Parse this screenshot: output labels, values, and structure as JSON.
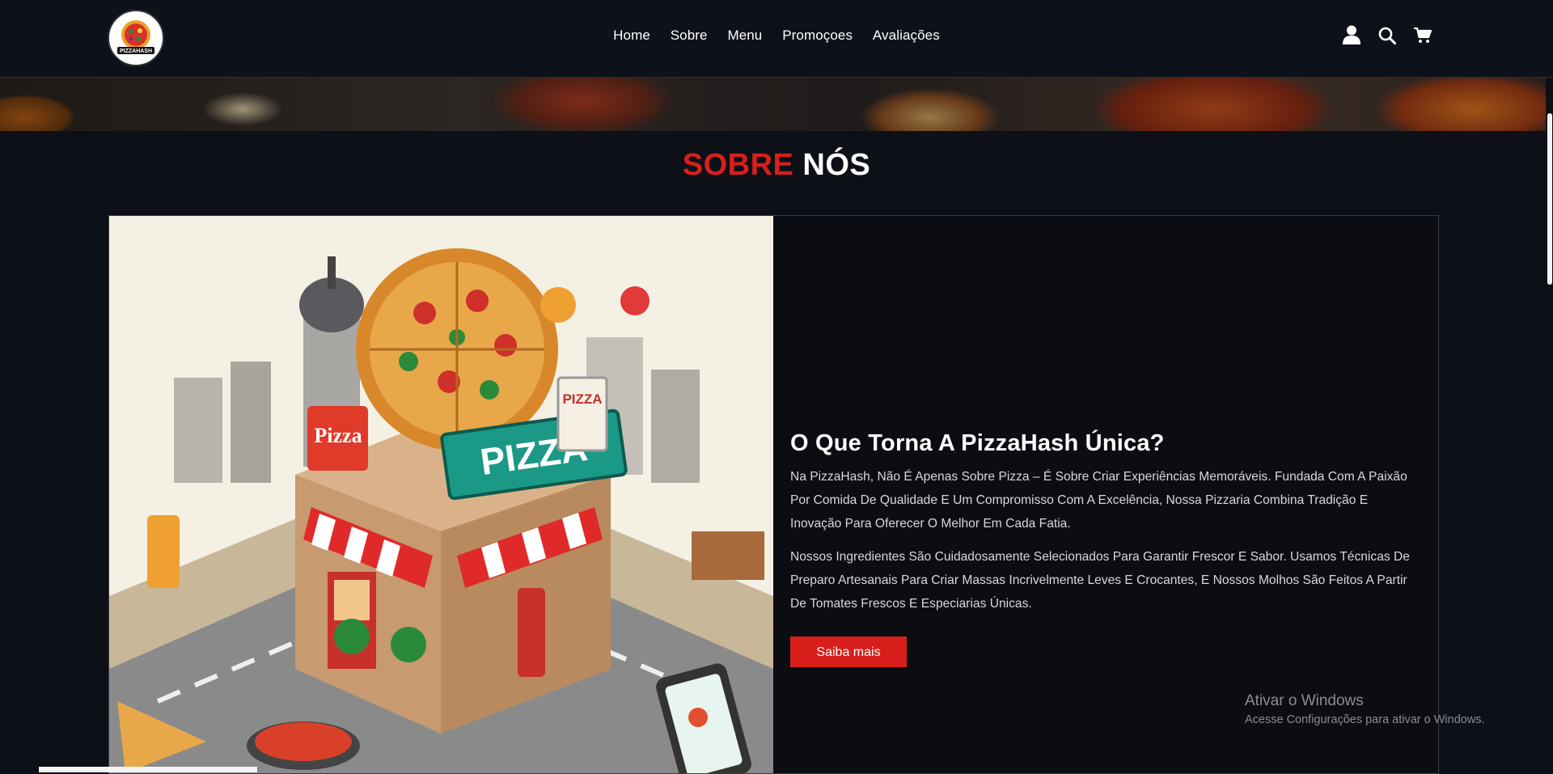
{
  "brand": {
    "logo_text": "PIZZAHASH"
  },
  "nav": {
    "items": [
      "Home",
      "Sobre",
      "Menu",
      "Promoçoes",
      "Avaliações"
    ]
  },
  "header_icons": [
    "user-icon",
    "search-icon",
    "cart-icon"
  ],
  "section": {
    "title_red": "SOBRE",
    "title_white": "NÓS"
  },
  "about": {
    "heading": "O Que Torna A PizzaHash Única?",
    "paragraph1": "Na PizzaHash, Não É Apenas Sobre Pizza – É Sobre Criar Experiências Memoráveis. Fundada Com A Paixão Por Comida De Qualidade E Um Compromisso Com A Excelência, Nossa Pizzaria Combina Tradição E Inovação Para Oferecer O Melhor Em Cada Fatia.",
    "paragraph2": "Nossos Ingredientes São Cuidadosamente Selecionados Para Garantir Frescor E Sabor. Usamos Técnicas De Preparo Artesanais Para Criar Massas Incrivelmente Leves E Crocantes, E Nossos Molhos São Feitos A Partir De Tomates Frescos E Especiarias Únicas.",
    "button_label": "Saiba mais"
  },
  "illustration": {
    "sign_main": "PIZZA",
    "sign_left": "Pizza",
    "sign_right": "PIZZA"
  },
  "watermark": {
    "line1": "Ativar o Windows",
    "line2": "Acesse Configurações para ativar o Windows."
  },
  "colors": {
    "accent": "#d81f1c",
    "background": "#0d1017",
    "sign_teal": "#1a9a86"
  }
}
